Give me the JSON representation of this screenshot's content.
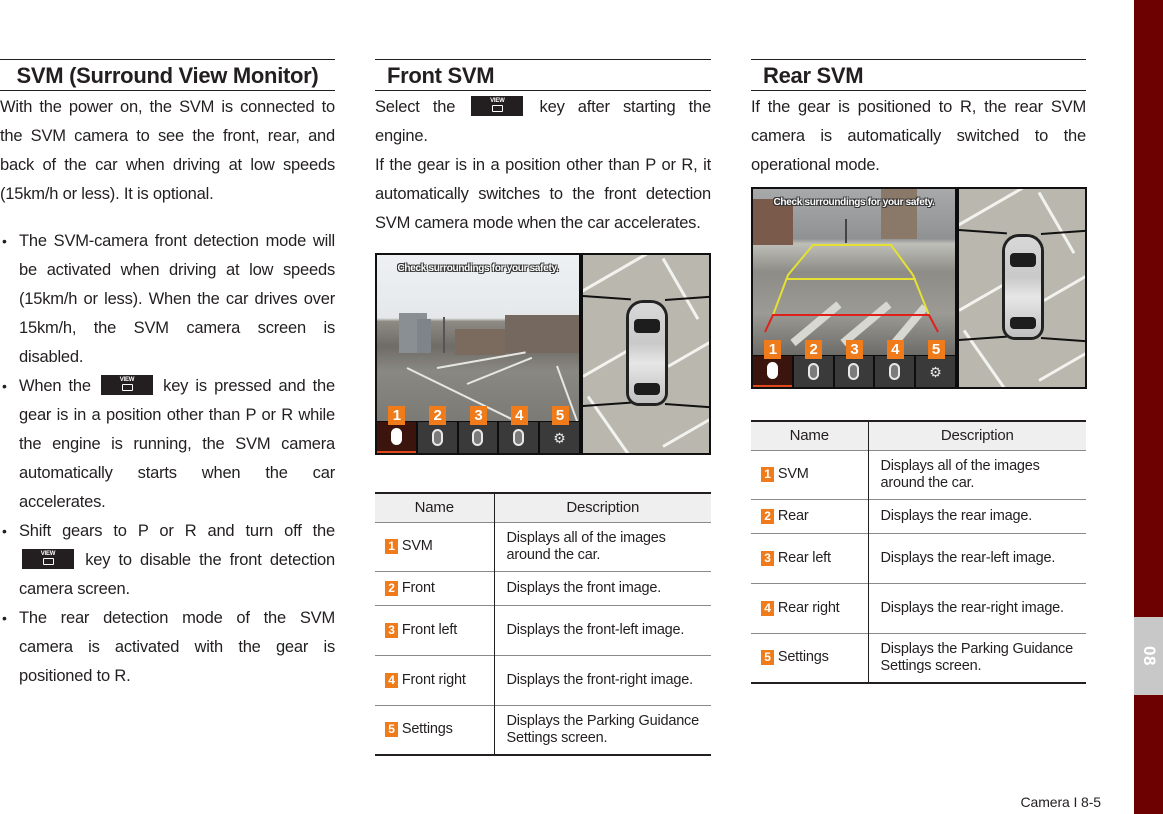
{
  "svm_section": {
    "title": "SVM (Surround View Monitor)",
    "intro": "With the power on, the SVM is connected to the SVM camera to see the front, rear, and back of the car when driving at low speeds (15km/h or less). It is optional.",
    "bullets": [
      {
        "text": "The SVM-camera front detection mode will be activated when driving at low speeds (15km/h or less). When the car drives over 15km/h, the SVM camera screen is disabled."
      },
      {
        "before_key": "When the",
        "after_key": "key is pressed and the gear is in a position other than P or R while the engine is running, the SVM camera automatically starts when the car accelerates."
      },
      {
        "before_key": "Shift gears to P or R and turn off the",
        "after_key": "key to disable the front detection camera screen."
      },
      {
        "text": "The rear detection mode of the SVM camera is activated with the gear is positioned to R."
      }
    ]
  },
  "view_key": {
    "label": "VIEW",
    "icon": "camera-view-icon"
  },
  "front_svm": {
    "title": "Front SVM",
    "para1_before_key": "Select the",
    "para1_after_key": "key after starting the engine.",
    "para2": "If the gear is in a position other than P or R, it automatically switches to the front detection SVM camera mode when the car accelerates.",
    "screen": {
      "caption": "Check surroundings for your safety.",
      "buttons": [
        {
          "num": "1",
          "icon": "svm-all-icon",
          "active": true
        },
        {
          "num": "2",
          "icon": "front-view-icon",
          "active": false
        },
        {
          "num": "3",
          "icon": "front-left-view-icon",
          "active": false
        },
        {
          "num": "4",
          "icon": "front-right-view-icon",
          "active": false
        },
        {
          "num": "5",
          "icon": "gear-icon",
          "active": false
        }
      ]
    },
    "table": {
      "headers": [
        "Name",
        "Description"
      ],
      "rows": [
        {
          "num": "1",
          "name": "SVM",
          "desc": "Displays all of the images around the car."
        },
        {
          "num": "2",
          "name": "Front",
          "desc": "Displays the front image."
        },
        {
          "num": "3",
          "name": "Front left",
          "desc": "Displays the front-left image."
        },
        {
          "num": "4",
          "name": "Front right",
          "desc": "Displays the front-right image."
        },
        {
          "num": "5",
          "name": "Settings",
          "desc": "Displays the Parking Guidance Settings screen."
        }
      ]
    }
  },
  "rear_svm": {
    "title": "Rear SVM",
    "para": "If the gear is positioned to R, the rear SVM camera is automatically switched to the operational mode.",
    "screen": {
      "caption": "Check surroundings for your safety.",
      "buttons": [
        {
          "num": "1",
          "icon": "svm-all-icon",
          "active": true
        },
        {
          "num": "2",
          "icon": "rear-view-icon",
          "active": false
        },
        {
          "num": "3",
          "icon": "rear-left-view-icon",
          "active": false
        },
        {
          "num": "4",
          "icon": "rear-right-view-icon",
          "active": false
        },
        {
          "num": "5",
          "icon": "gear-icon",
          "active": false
        }
      ]
    },
    "table": {
      "headers": [
        "Name",
        "Description"
      ],
      "rows": [
        {
          "num": "1",
          "name": "SVM",
          "desc": "Displays all of the images around the car."
        },
        {
          "num": "2",
          "name": "Rear",
          "desc": "Displays the rear image."
        },
        {
          "num": "3",
          "name": "Rear left",
          "desc": "Displays the rear-left image."
        },
        {
          "num": "4",
          "name": "Rear right",
          "desc": "Displays the rear-right image."
        },
        {
          "num": "5",
          "name": "Settings",
          "desc": "Displays the Parking Guidance Settings screen."
        }
      ]
    }
  },
  "chapter_tab": "08",
  "footer": "Camera I 8-5",
  "colors": {
    "chapter_bar": "#6d0000",
    "chapter_tab": "#c8c8c8",
    "badge": "#ef7b1a",
    "guide_yellow": "#e6e033",
    "guide_red": "#e0201a"
  }
}
